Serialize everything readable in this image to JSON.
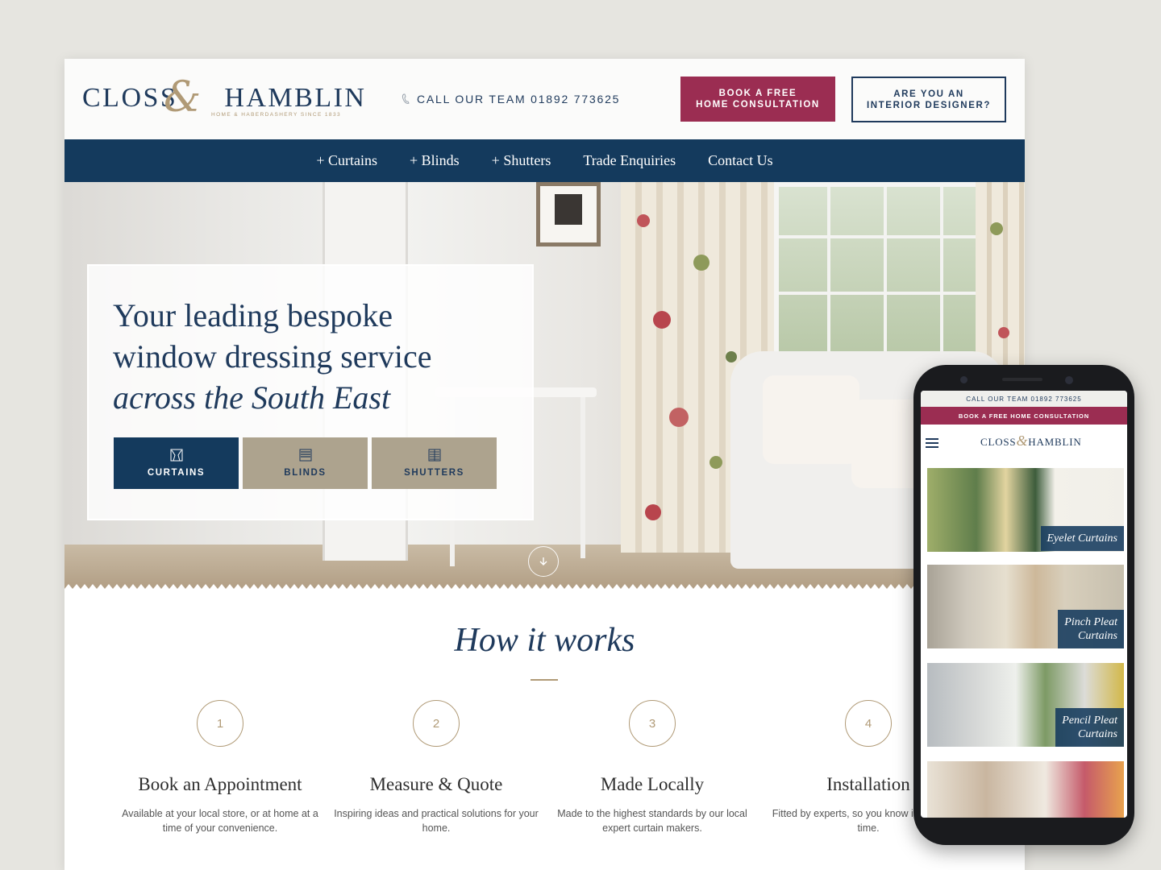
{
  "brand": {
    "logo_text": "CLOSS&HAMBLIN",
    "logo_left": "CLOSS",
    "logo_amp": "&",
    "logo_right": "HAMBLIN",
    "tagline": "HOME & HABERDASHERY SINCE 1833"
  },
  "header": {
    "call_label": "CALL OUR TEAM 01892 773625",
    "book_button_line1": "BOOK A FREE",
    "book_button_line2": "HOME CONSULTATION",
    "designer_button_line1": "ARE YOU AN",
    "designer_button_line2": "INTERIOR DESIGNER?"
  },
  "nav": {
    "items": [
      "+ Curtains",
      "+ Blinds",
      "+ Shutters",
      "Trade Enquiries",
      "Contact Us"
    ]
  },
  "hero": {
    "title_line1": "Your leading bespoke",
    "title_line2": "window dressing service",
    "title_line3": "across the South East",
    "ctas": [
      "CURTAINS",
      "BLINDS",
      "SHUTTERS"
    ]
  },
  "how": {
    "title": "How it works",
    "steps": [
      {
        "num": "1",
        "title": "Book an Appointment",
        "desc": "Available at your local store, or at home at a time of your convenience."
      },
      {
        "num": "2",
        "title": "Measure & Quote",
        "desc": "Inspiring ideas and practical solutions for your home."
      },
      {
        "num": "3",
        "title": "Made Locally",
        "desc": "Made to the highest standards by our local expert curtain makers."
      },
      {
        "num": "4",
        "title": "Installation",
        "desc": "Fitted by experts, so you know it's right first time."
      }
    ]
  },
  "mobile": {
    "call_label": "CALL OUR TEAM 01892 773625",
    "book_label": "BOOK A FREE HOME CONSULTATION",
    "logo_left": "CLOSS",
    "logo_amp": "&",
    "logo_right": "HAMBLIN",
    "tiles": [
      "Eyelet Curtains",
      "Pinch Pleat Curtains",
      "Pencil Pleat Curtains"
    ],
    "tile_lines": [
      [
        "Eyelet Curtains"
      ],
      [
        "Pinch Pleat",
        "Curtains"
      ],
      [
        "Pencil Pleat",
        "Curtains"
      ]
    ]
  },
  "colors": {
    "navy": "#143a5d",
    "plum": "#9b2d52",
    "gold": "#b09a76",
    "taupe": "#ada38e"
  },
  "icons": [
    "phone-icon",
    "curtains-icon",
    "blinds-icon",
    "shutters-icon",
    "chevron-down-icon",
    "hamburger-menu-icon"
  ]
}
